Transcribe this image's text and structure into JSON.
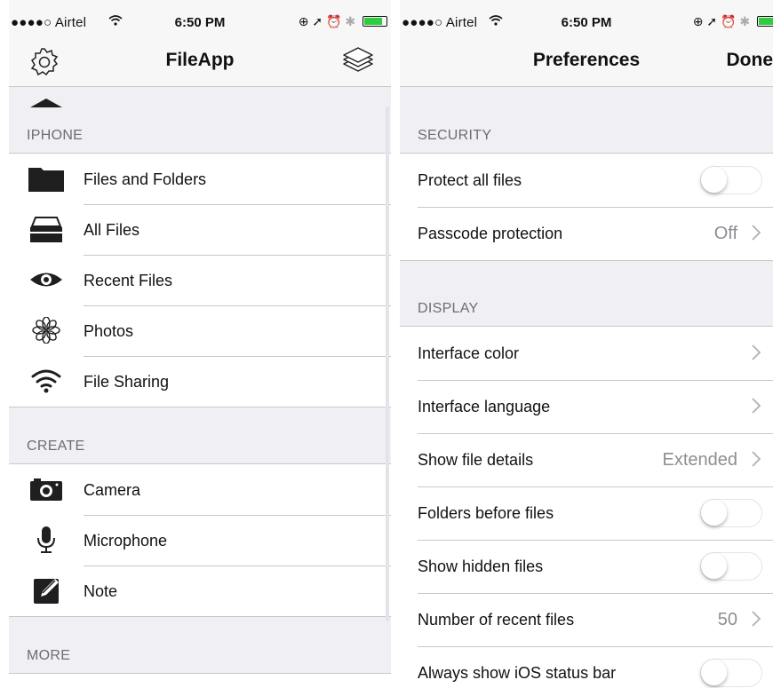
{
  "left": {
    "status": {
      "carrier": "●●●●○ Airtel",
      "time": "6:50 PM"
    },
    "nav": {
      "title": "FileApp",
      "left_icon": "gear-icon",
      "right_icon": "layers-icon"
    },
    "sections": [
      {
        "header": "IPHONE",
        "items": [
          {
            "label": "Files and Folders",
            "icon": "folder-icon"
          },
          {
            "label": "All Files",
            "icon": "tray-icon"
          },
          {
            "label": "Recent Files",
            "icon": "eye-icon"
          },
          {
            "label": "Photos",
            "icon": "flower-icon"
          },
          {
            "label": "File Sharing",
            "icon": "wifi-icon"
          }
        ]
      },
      {
        "header": "CREATE",
        "items": [
          {
            "label": "Camera",
            "icon": "camera-icon"
          },
          {
            "label": "Microphone",
            "icon": "microphone-icon"
          },
          {
            "label": "Note",
            "icon": "note-icon"
          }
        ]
      },
      {
        "header": "MORE",
        "items": []
      }
    ]
  },
  "right": {
    "status": {
      "carrier": "●●●●○ Airtel",
      "time": "6:50 PM"
    },
    "nav": {
      "title": "Preferences",
      "done": "Done"
    },
    "sections": [
      {
        "header": "SECURITY",
        "rows": [
          {
            "label": "Protect all files",
            "type": "toggle",
            "on": false
          },
          {
            "label": "Passcode protection",
            "type": "disclosure",
            "value": "Off"
          }
        ]
      },
      {
        "header": "DISPLAY",
        "rows": [
          {
            "label": "Interface color",
            "type": "disclosure",
            "value": ""
          },
          {
            "label": "Interface language",
            "type": "disclosure",
            "value": ""
          },
          {
            "label": "Show file details",
            "type": "disclosure",
            "value": "Extended"
          },
          {
            "label": "Folders before files",
            "type": "toggle",
            "on": false
          },
          {
            "label": "Show hidden files",
            "type": "toggle",
            "on": false
          },
          {
            "label": "Number of recent files",
            "type": "disclosure",
            "value": "50"
          },
          {
            "label": "Always show iOS status bar",
            "type": "toggle",
            "on": false
          }
        ]
      }
    ]
  },
  "colors": {
    "background": "#efeff4",
    "separator": "#c8c7cc",
    "section_text": "#6d6d72",
    "value_text": "#8e8e93",
    "battery": "#2ecc40"
  }
}
